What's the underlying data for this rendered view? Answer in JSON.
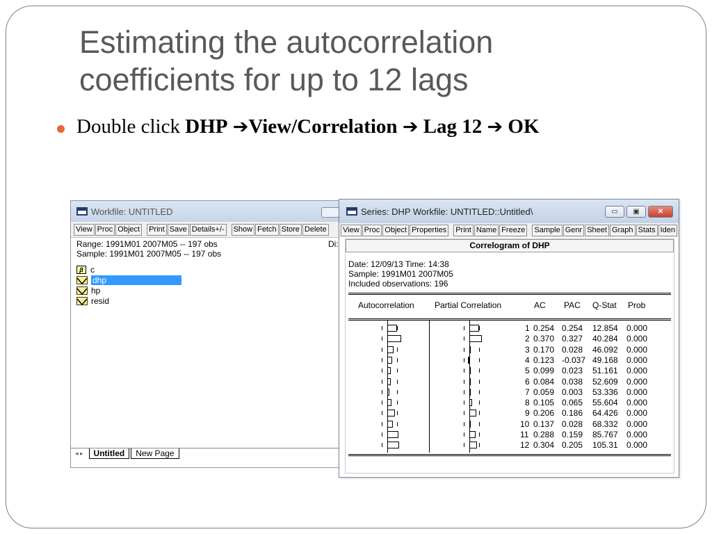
{
  "slide": {
    "title_line1": "Estimating the autocorrelation",
    "title_line2": "coefficients for up to 12 lags",
    "bullet_prefix": "Double click ",
    "bullet_dhp": "DHP",
    "bullet_arrow": "➔",
    "bullet_view": "View/Correlation",
    "bullet_lag": "Lag 12",
    "bullet_ok": "OK",
    "bullet_color": "#e8683a",
    "title_color": "#595959"
  },
  "workfile": {
    "title": "Workfile: UNTITLED",
    "toolbar": [
      "View",
      "Proc",
      "Object",
      "Print",
      "Save",
      "Details+/-",
      "Show",
      "Fetch",
      "Store",
      "Delete"
    ],
    "range": "Range:  1991M01 2007M05   --   197 obs",
    "sample": "Sample: 1991M01 2007M05   --   197 obs",
    "dis": "Di:",
    "objects": [
      {
        "name": "c",
        "icon": "beta-icon"
      },
      {
        "name": "dhp",
        "icon": "series-icon",
        "selected": true
      },
      {
        "name": "hp",
        "icon": "series-icon"
      },
      {
        "name": "resid",
        "icon": "series-icon"
      }
    ],
    "tabs": [
      "Untitled",
      "New Page"
    ],
    "tab_arrows": "◂ ▸"
  },
  "series": {
    "title": "Series: DHP   Workfile: UNTITLED::Untitled\\",
    "toolbar": [
      "View",
      "Proc",
      "Object",
      "Properties",
      "Print",
      "Name",
      "Freeze",
      "Sample",
      "Genr",
      "Sheet",
      "Graph",
      "Stats",
      "Iden"
    ],
    "controls": {
      "minimize": "▭",
      "maximize": "▣",
      "close": "✕"
    },
    "header": "Correlogram of DHP",
    "date": "Date: 12/09/13   Time: 14:38",
    "sample": "Sample: 1991M01 2007M05",
    "included": "Included observations: 196",
    "columns": {
      "autocorrelation": "Autocorrelation",
      "partial": "Partial Correlation",
      "ac": "AC",
      "pac": "PAC",
      "qstat": "Q-Stat",
      "prob": "Prob"
    },
    "rows": [
      {
        "lag": "1",
        "ac": "0.254",
        "pac": "0.254",
        "q": "12.854",
        "prob": "0.000"
      },
      {
        "lag": "2",
        "ac": "0.370",
        "pac": "0.327",
        "q": "40.284",
        "prob": "0.000"
      },
      {
        "lag": "3",
        "ac": "0.170",
        "pac": "0.028",
        "q": "46.092",
        "prob": "0.000"
      },
      {
        "lag": "4",
        "ac": "0.123",
        "pac": "-0.037",
        "q": "49.168",
        "prob": "0.000"
      },
      {
        "lag": "5",
        "ac": "0.099",
        "pac": "0.023",
        "q": "51.161",
        "prob": "0.000"
      },
      {
        "lag": "6",
        "ac": "0.084",
        "pac": "0.038",
        "q": "52.609",
        "prob": "0.000"
      },
      {
        "lag": "7",
        "ac": "0.059",
        "pac": "0.003",
        "q": "53.336",
        "prob": "0.000"
      },
      {
        "lag": "8",
        "ac": "0.105",
        "pac": "0.065",
        "q": "55.604",
        "prob": "0.000"
      },
      {
        "lag": "9",
        "ac": "0.206",
        "pac": "0.186",
        "q": "64.426",
        "prob": "0.000"
      },
      {
        "lag": "10",
        "ac": "0.137",
        "pac": "0.028",
        "q": "68.332",
        "prob": "0.000"
      },
      {
        "lag": "11",
        "ac": "0.288",
        "pac": "0.159",
        "q": "85.767",
        "prob": "0.000"
      },
      {
        "lag": "12",
        "ac": "0.304",
        "pac": "0.205",
        "q": "105.31",
        "prob": "0.000"
      }
    ]
  }
}
